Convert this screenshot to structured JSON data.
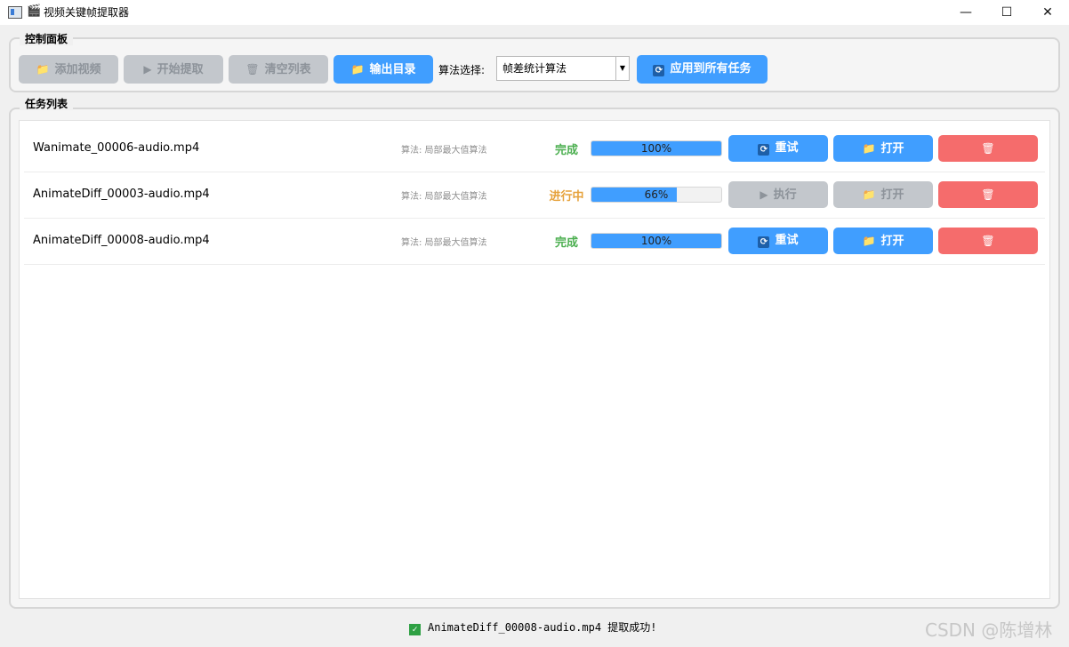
{
  "window": {
    "title": "视频关键帧提取器",
    "minimize": "—",
    "maximize": "☐",
    "close": "✕"
  },
  "control_panel": {
    "title": "控制面板",
    "add_video": "添加视频",
    "start_extract": "开始提取",
    "clear_list": "清空列表",
    "output_dir": "输出目录",
    "algo_label": "算法选择:",
    "algo_selected": "帧差统计算法",
    "apply_all": "应用到所有任务"
  },
  "task_list": {
    "title": "任务列表",
    "tasks": [
      {
        "file": "Wanimate_00006-audio.mp4",
        "algo": "算法: 局部最大值算法",
        "status": "完成",
        "progress": 100,
        "progress_text": "100%",
        "action": "重试",
        "open": "打开"
      },
      {
        "file": "AnimateDiff_00003-audio.mp4",
        "algo": "算法: 局部最大值算法",
        "status": "进行中",
        "progress": 66,
        "progress_text": "66%",
        "action": "执行",
        "open": "打开"
      },
      {
        "file": "AnimateDiff_00008-audio.mp4",
        "algo": "算法: 局部最大值算法",
        "status": "完成",
        "progress": 100,
        "progress_text": "100%",
        "action": "重试",
        "open": "打开"
      }
    ]
  },
  "status_bar": {
    "message": "AnimateDiff_00008-audio.mp4 提取成功!"
  },
  "watermark": "CSDN @陈增林",
  "colors": {
    "primary": "#409eff",
    "danger": "#f56c6c",
    "disabled": "#c3c7cc",
    "done": "#4caf50",
    "running": "#e6a23c"
  }
}
